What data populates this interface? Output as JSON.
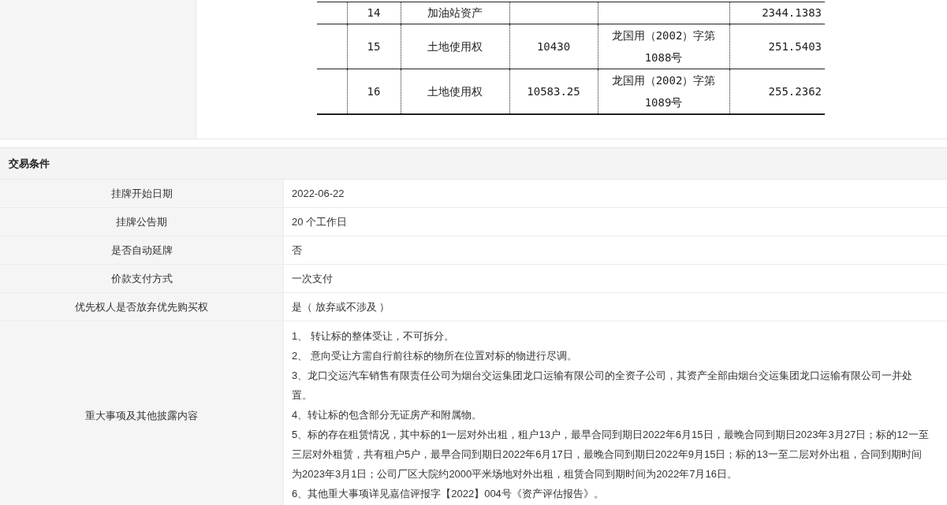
{
  "asset_table": {
    "rows": [
      {
        "no": "14",
        "name": "加油站资产",
        "area": "",
        "certificate": "",
        "value": "2344.1383"
      },
      {
        "no": "15",
        "name": "土地使用权",
        "area": "10430",
        "certificate": "龙国用（2002）字第1088号",
        "value": "251.5403"
      },
      {
        "no": "16",
        "name": "土地使用权",
        "area": "10583.25",
        "certificate": "龙国用（2002）字第1089号",
        "value": "255.2362"
      }
    ]
  },
  "trade_conditions": {
    "title": "交易条件",
    "rows": [
      {
        "label": "挂牌开始日期",
        "value": "2022-06-22"
      },
      {
        "label": "挂牌公告期",
        "value": "20 个工作日"
      },
      {
        "label": "是否自动延牌",
        "value": "否"
      },
      {
        "label": "价款支付方式",
        "value": "一次支付"
      },
      {
        "label": "优先权人是否放弃优先购买权",
        "value": "是（ 放弃或不涉及 ）"
      }
    ],
    "disclosure": {
      "label": "重大事项及其他披露内容",
      "paragraphs": [
        "1、 转让标的整体受让，不可拆分。",
        "2、 意向受让方需自行前往标的物所在位置对标的物进行尽调。",
        "3、龙口交运汽车销售有限责任公司为烟台交运集团龙口运输有限公司的全资子公司，其资产全部由烟台交运集团龙口运输有限公司一并处置。",
        "4、转让标的包含部分无证房产和附属物。",
        "5、标的存在租赁情况，其中标的1一层对外出租，租户13户，最早合同到期日2022年6月15日，最晚合同到期日2023年3月27日；标的12一至三层对外租赁，共有租户5户，最早合同到期日2022年6月17日，最晚合同到期日2022年9月15日；标的13一至二层对外出租，合同到期时间为2023年3月1日；公司厂区大院约2000平米场地对外出租，租赁合同到期时间为2022年7月16日。",
        "6、其他重大事项详见嘉信评报字【2022】004号《资产评估报告》。"
      ]
    }
  }
}
